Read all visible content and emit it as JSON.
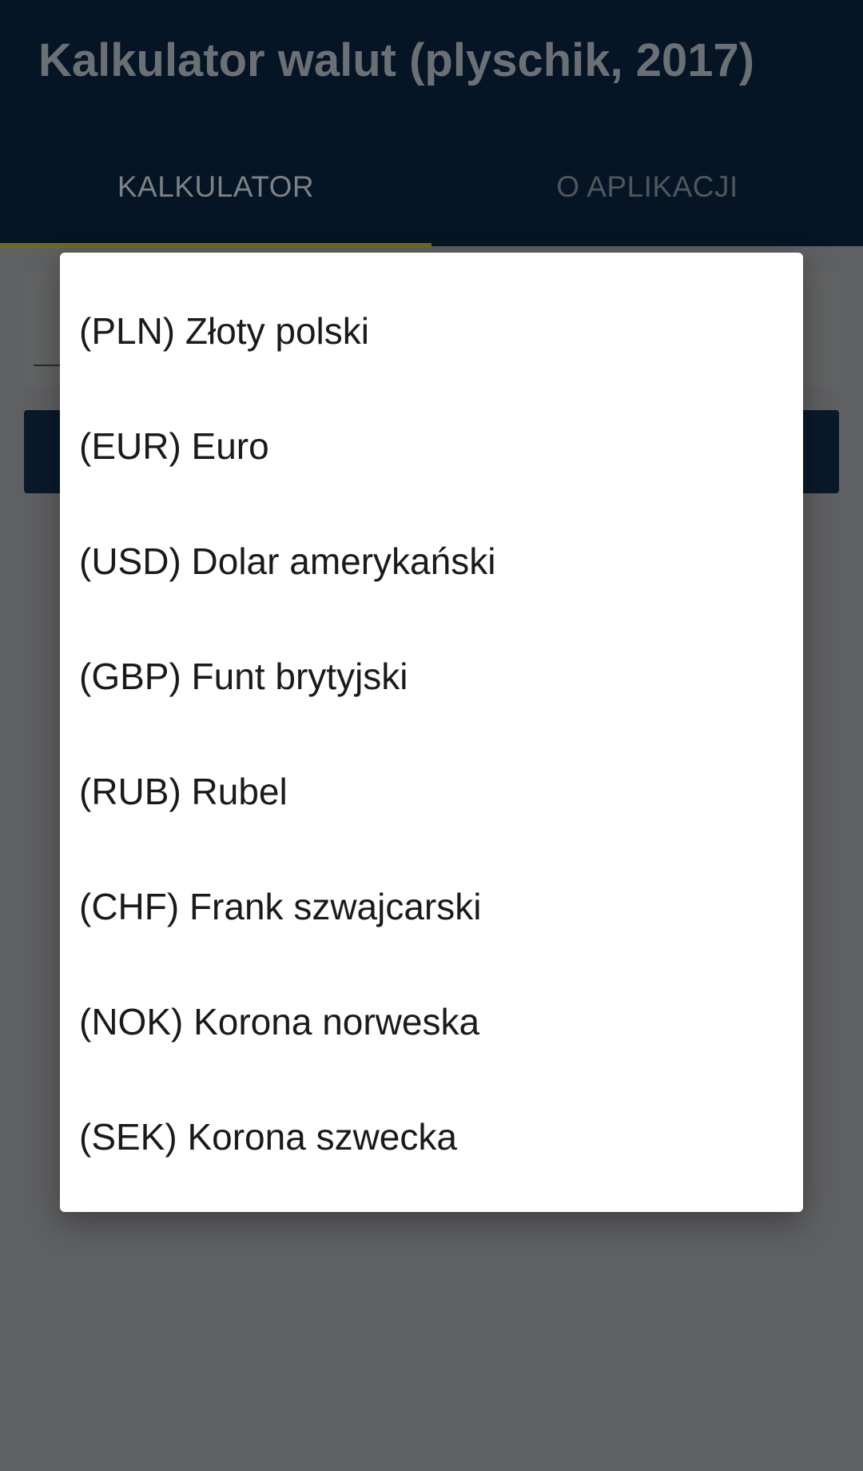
{
  "app": {
    "title": "Kalkulator walut (plyschik, 2017)"
  },
  "tabs": [
    {
      "label": "KALKULATOR",
      "selected": true
    },
    {
      "label": "O APLIKACJI",
      "selected": false
    }
  ],
  "colors": {
    "app_bar": "#051525",
    "tab_indicator": "#6f6c1e",
    "scrim_background": "#5f6062",
    "dialog_background": "#ffffff"
  },
  "currency_dialog": {
    "options": [
      "(PLN) Złoty polski",
      "(EUR) Euro",
      "(USD) Dolar amerykański",
      "(GBP) Funt brytyjski",
      "(RUB) Rubel",
      "(CHF) Frank szwajcarski",
      "(NOK) Korona norweska",
      "(SEK) Korona szwecka"
    ]
  }
}
